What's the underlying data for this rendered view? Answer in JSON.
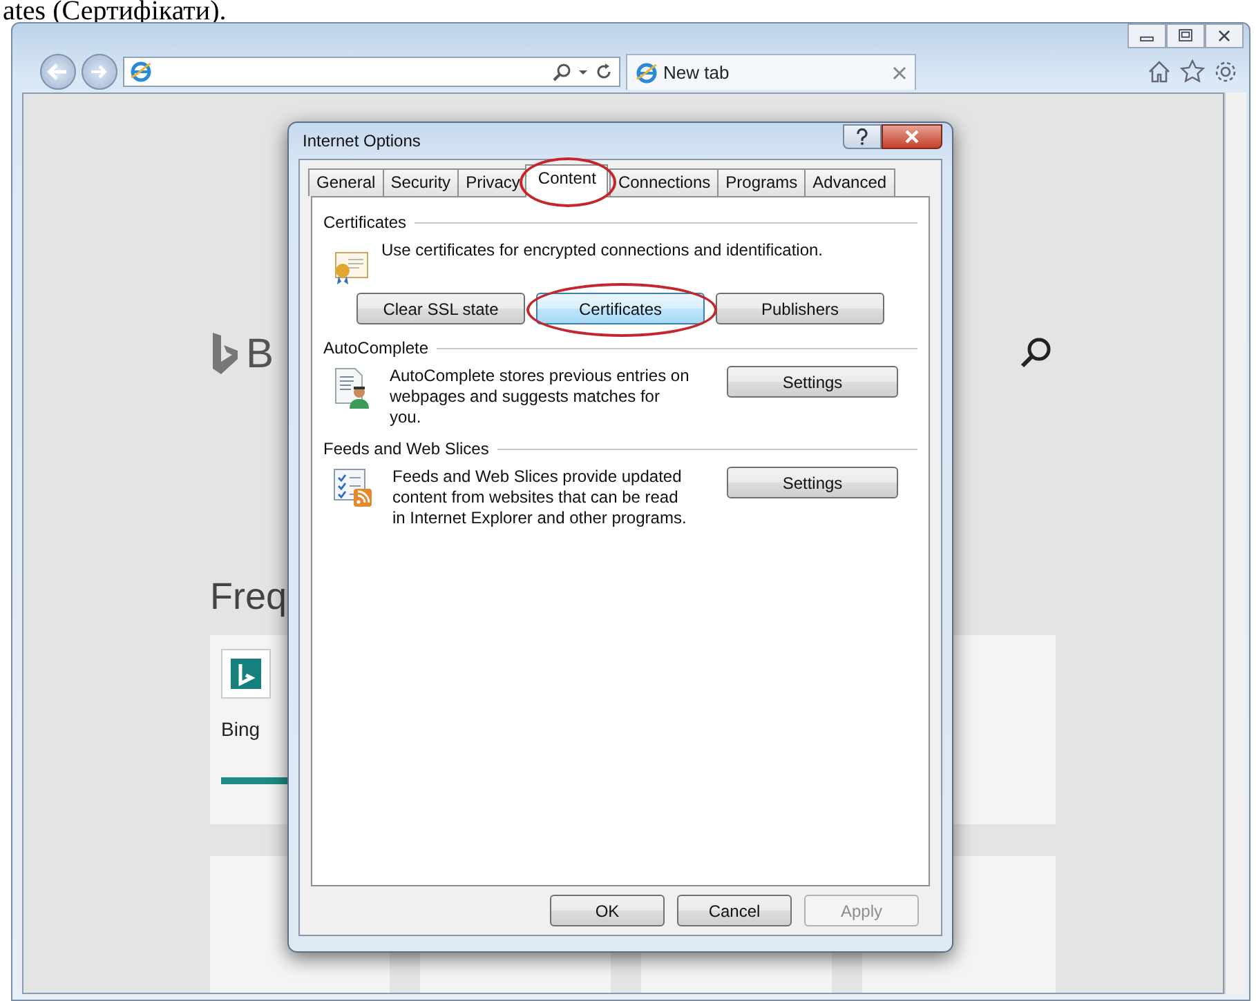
{
  "document_caption": "ates (Сертифікати).",
  "browser": {
    "tab_label": "New tab"
  },
  "page": {
    "logo_text": "B",
    "section_heading": "Freq",
    "tiles": [
      {
        "label": "Bing"
      }
    ]
  },
  "dialog": {
    "title": "Internet Options",
    "tabs": [
      {
        "label": "General",
        "selected": false,
        "circled": false
      },
      {
        "label": "Security",
        "selected": false,
        "circled": false
      },
      {
        "label": "Privacy",
        "selected": false,
        "circled": false
      },
      {
        "label": "Content",
        "selected": true,
        "circled": true
      },
      {
        "label": "Connections",
        "selected": false,
        "circled": false
      },
      {
        "label": "Programs",
        "selected": false,
        "circled": false
      },
      {
        "label": "Advanced",
        "selected": false,
        "circled": false
      }
    ],
    "groups": [
      {
        "kind": "certificates",
        "title": "Certificates",
        "description": "Use certificates for encrypted connections and identification.",
        "buttons": [
          {
            "label": "Clear SSL state",
            "focused": false,
            "circled": false
          },
          {
            "label": "Certificates",
            "focused": true,
            "circled": true
          },
          {
            "label": "Publishers",
            "focused": false,
            "circled": false
          }
        ]
      },
      {
        "kind": "autocomplete",
        "title": "AutoComplete",
        "description": "AutoComplete stores previous entries on webpages and suggests matches for you.",
        "buttons": [
          {
            "label": "Settings",
            "focused": false,
            "circled": false
          }
        ]
      },
      {
        "kind": "feeds",
        "title": "Feeds and Web Slices",
        "description": "Feeds and Web Slices provide updated content from websites that can be read in Internet Explorer and other programs.",
        "buttons": [
          {
            "label": "Settings",
            "focused": false,
            "circled": false
          }
        ]
      }
    ],
    "footer_buttons": [
      {
        "label": "OK",
        "disabled": false
      },
      {
        "label": "Cancel",
        "disabled": false
      },
      {
        "label": "Apply",
        "disabled": true
      }
    ]
  }
}
